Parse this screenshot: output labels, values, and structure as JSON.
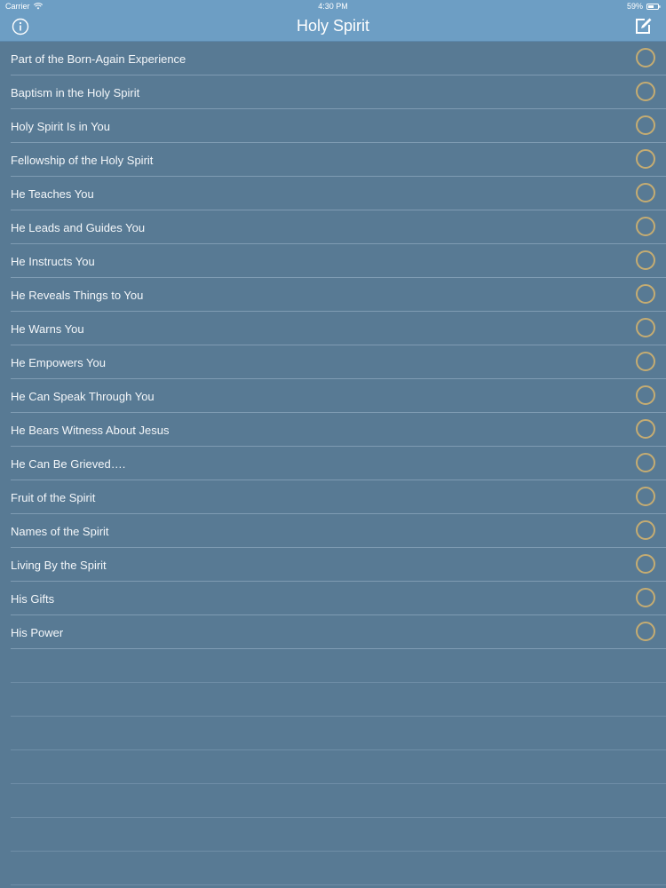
{
  "status_bar": {
    "carrier": "Carrier",
    "time": "4:30 PM",
    "battery": "59%"
  },
  "nav": {
    "title": "Holy Spirit",
    "info_icon": "info-circle-icon",
    "compose_icon": "compose-edit-icon"
  },
  "items": [
    {
      "label": "Part of the Born-Again Experience"
    },
    {
      "label": "Baptism in the Holy Spirit"
    },
    {
      "label": "Holy Spirit Is in You"
    },
    {
      "label": "Fellowship of the Holy Spirit"
    },
    {
      "label": "He Teaches You"
    },
    {
      "label": "He Leads and Guides You"
    },
    {
      "label": "He Instructs You"
    },
    {
      "label": "He Reveals Things to You"
    },
    {
      "label": "He Warns You"
    },
    {
      "label": "He Empowers You"
    },
    {
      "label": "He Can Speak Through You"
    },
    {
      "label": "He Bears Witness About Jesus"
    },
    {
      "label": "He Can Be Grieved…."
    },
    {
      "label": "Fruit of the Spirit"
    },
    {
      "label": "Names of the Spirit"
    },
    {
      "label": "Living By the Spirit"
    },
    {
      "label": "His Gifts"
    },
    {
      "label": "His Power"
    }
  ],
  "colors": {
    "background": "#587a94",
    "nav_background": "#6d9ec4",
    "circle_accent": "#c5ac72"
  }
}
